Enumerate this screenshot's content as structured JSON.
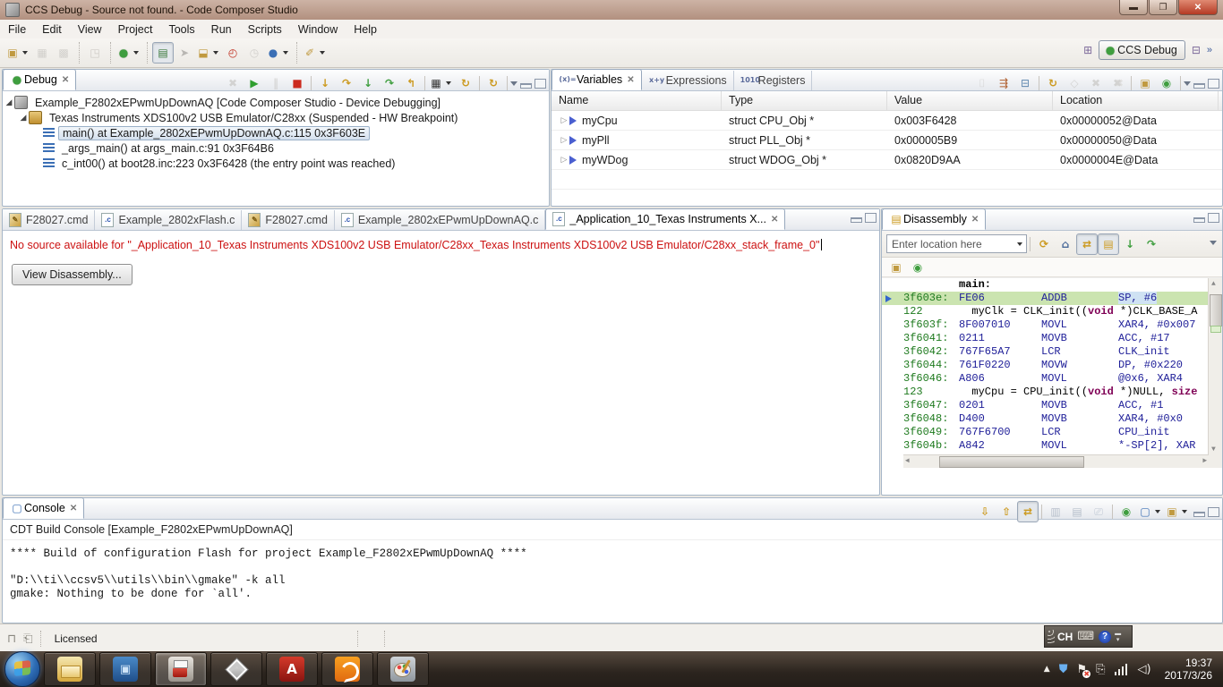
{
  "window": {
    "title": "CCS Debug - Source not found. - Code Composer Studio",
    "menus": [
      "File",
      "Edit",
      "View",
      "Project",
      "Tools",
      "Run",
      "Scripts",
      "Window",
      "Help"
    ],
    "window_buttons": [
      "minimize",
      "restore",
      "close"
    ],
    "perspective_label": "CCS Debug",
    "toolbar_groups": [
      [
        "new-wizard|dd",
        "save|dis",
        "save-all|dis"
      ],
      [
        "navigate|dis"
      ],
      [
        "debug-bug|dd"
      ],
      [
        "flash|pressed",
        "step-filter",
        "load-program|dd",
        "profile-clock",
        "clock-gray|dis",
        "target-sphere|dd"
      ],
      [
        "connect-probe|dd"
      ]
    ]
  },
  "debug_panel": {
    "tab": "Debug",
    "toolbar": [
      "disconnect|dis",
      "resume",
      "suspend|dis",
      "terminate",
      "|",
      "step-into",
      "step-over",
      "step-into2",
      "step-over2",
      "step-return",
      "|",
      "chip|dd",
      "restart",
      "|",
      "refresh"
    ],
    "tree": [
      {
        "level": 0,
        "icon": "ccs-project-icon",
        "twisty": "expanded",
        "text": "Example_F2802xEPwmUpDownAQ [Code Composer Studio - Device Debugging]",
        "selected": false
      },
      {
        "level": 1,
        "icon": "emulator-icon",
        "twisty": "expanded",
        "text": "Texas Instruments XDS100v2 USB Emulator/C28xx (Suspended - HW Breakpoint)",
        "selected": false
      },
      {
        "level": 2,
        "icon": "stack-frame-icon",
        "twisty": "none",
        "text": "main() at Example_2802xEPwmUpDownAQ.c:115 0x3F603E",
        "selected": true
      },
      {
        "level": 2,
        "icon": "stack-frame-icon",
        "twisty": "none",
        "text": "_args_main() at args_main.c:91 0x3F64B6",
        "selected": false
      },
      {
        "level": 2,
        "icon": "stack-frame-icon",
        "twisty": "none",
        "text": "c_int00() at boot28.inc:223 0x3F6428  (the entry point was reached)",
        "selected": false
      }
    ]
  },
  "variables_panel": {
    "tabs": [
      {
        "label": "Variables",
        "icon": "variables-icon",
        "active": true,
        "closable": true
      },
      {
        "label": "Expressions",
        "icon": "expressions-icon",
        "active": false,
        "closable": false
      },
      {
        "label": "Registers",
        "icon": "registers-icon",
        "active": false,
        "closable": false
      }
    ],
    "toolbar": [
      "show-types|dis",
      "tree-mode",
      "collapse-all",
      "|",
      "refresh",
      "lock-gray|dis",
      "delete|dis",
      "delete-all|dis",
      "|",
      "new-view",
      "pin"
    ],
    "columns": [
      {
        "label": "Name",
        "width": 190
      },
      {
        "label": "Type",
        "width": 185
      },
      {
        "label": "Value",
        "width": 185
      },
      {
        "label": "Location",
        "width": 185
      }
    ],
    "rows": [
      {
        "name": "myCpu",
        "type": "struct CPU_Obj *",
        "value": "0x003F6428",
        "location": "0x00000052@Data"
      },
      {
        "name": "myPll",
        "type": "struct PLL_Obj *",
        "value": "0x000005B9",
        "location": "0x00000050@Data"
      },
      {
        "name": "myWDog",
        "type": "struct WDOG_Obj *",
        "value": "0x0820D9AA",
        "location": "0x0000004E@Data"
      }
    ],
    "empty_rows": 2
  },
  "editor": {
    "tabs": [
      {
        "label": "F28027.cmd",
        "icon": "cmd-file-icon",
        "active": false,
        "closable": false
      },
      {
        "label": "Example_2802xFlash.c",
        "icon": "c-file-icon",
        "active": false,
        "closable": false
      },
      {
        "label": "F28027.cmd",
        "icon": "cmd-file-icon",
        "active": false,
        "closable": false
      },
      {
        "label": "Example_2802xEPwmUpDownAQ.c",
        "icon": "c-file-icon",
        "active": false,
        "closable": false
      },
      {
        "label": "_Application_10_Texas Instruments X...",
        "icon": "c-file-icon",
        "active": true,
        "closable": true
      }
    ],
    "message": "No source available for \"_Application_10_Texas Instruments XDS100v2 USB Emulator/C28xx_Texas Instruments XDS100v2 USB Emulator/C28xx_stack_frame_0\"",
    "button_label": "View Disassembly..."
  },
  "disassembly_panel": {
    "tab": "Disassembly",
    "location_placeholder": "Enter location here",
    "toolbar": [
      "refresh-dis",
      "home",
      "link-active|pressed",
      "show-source|pressed",
      "step-g1",
      "step-g2"
    ],
    "row2": [
      "new-view",
      "pin"
    ],
    "lines": [
      {
        "type": "label",
        "text": "main:"
      },
      {
        "type": "asm",
        "addr": "3f603e:",
        "code": "FE06",
        "mn": "ADDB",
        "op": "SP, #6",
        "current": true
      },
      {
        "type": "src",
        "num": "122",
        "text": "myClk = CLK_init((void *)CLK_BASE_A"
      },
      {
        "type": "asm",
        "addr": "3f603f:",
        "code": "8F007010",
        "mn": "MOVL",
        "op": "XAR4, #0x007"
      },
      {
        "type": "asm",
        "addr": "3f6041:",
        "code": "0211",
        "mn": "MOVB",
        "op": "ACC, #17"
      },
      {
        "type": "asm",
        "addr": "3f6042:",
        "code": "767F65A7",
        "mn": "LCR",
        "op": "CLK_init"
      },
      {
        "type": "asm",
        "addr": "3f6044:",
        "code": "761F0220",
        "mn": "MOVW",
        "op": "DP, #0x220"
      },
      {
        "type": "asm",
        "addr": "3f6046:",
        "code": "A806",
        "mn": "MOVL",
        "op": "@0x6, XAR4"
      },
      {
        "type": "src",
        "num": "123",
        "text": "myCpu = CPU_init((void *)NULL, size"
      },
      {
        "type": "asm",
        "addr": "3f6047:",
        "code": "0201",
        "mn": "MOVB",
        "op": "ACC, #1"
      },
      {
        "type": "asm",
        "addr": "3f6048:",
        "code": "D400",
        "mn": "MOVB",
        "op": "XAR4, #0x0"
      },
      {
        "type": "asm",
        "addr": "3f6049:",
        "code": "767F6700",
        "mn": "LCR",
        "op": "CPU_init"
      },
      {
        "type": "asm",
        "addr": "3f604b:",
        "code": "A842",
        "mn": "MOVL",
        "op": "*-SP[2], XAR"
      }
    ],
    "keywords": [
      "void",
      "size"
    ]
  },
  "console_panel": {
    "tab": "Console",
    "toolbar": [
      "scroll-lock-down",
      "scroll-lock-up",
      "link-console|pressed",
      "|",
      "console-monitor|dis",
      "console-lock|dis",
      "clear-console|dis",
      "|",
      "pin",
      "display-select|dd",
      "new-view|dd"
    ],
    "subtitle": "CDT Build Console [Example_F2802xEPwmUpDownAQ]",
    "lines": [
      "**** Build of configuration Flash for project Example_F2802xEPwmUpDownAQ ****",
      "",
      "\"D:\\\\ti\\\\ccsv5\\\\utils\\\\bin\\\\gmake\" -k all",
      "gmake: Nothing to be done for `all'."
    ]
  },
  "status_bar": {
    "license_label": "Licensed"
  },
  "language_bar": {
    "label": "CH"
  },
  "taskbar": {
    "apps": [
      {
        "name": "windows-explorer",
        "cls": "a-explorer",
        "glyph": "",
        "active": false
      },
      {
        "name": "media-app",
        "cls": "a-media",
        "glyph": "▣",
        "active": false
      },
      {
        "name": "code-composer-studio",
        "cls": "a-ccs",
        "glyph": "",
        "active": true
      },
      {
        "name": "cube-app",
        "cls": "a-cube",
        "glyph": "",
        "active": false
      },
      {
        "name": "adobe-reader",
        "cls": "a-adobe",
        "glyph": "A",
        "active": false
      },
      {
        "name": "uc-browser",
        "cls": "a-uc",
        "glyph": "",
        "active": false
      },
      {
        "name": "paint",
        "cls": "a-paint",
        "glyph": "",
        "active": false
      }
    ],
    "clock_time": "19:37",
    "clock_date": "2017/3/26"
  }
}
